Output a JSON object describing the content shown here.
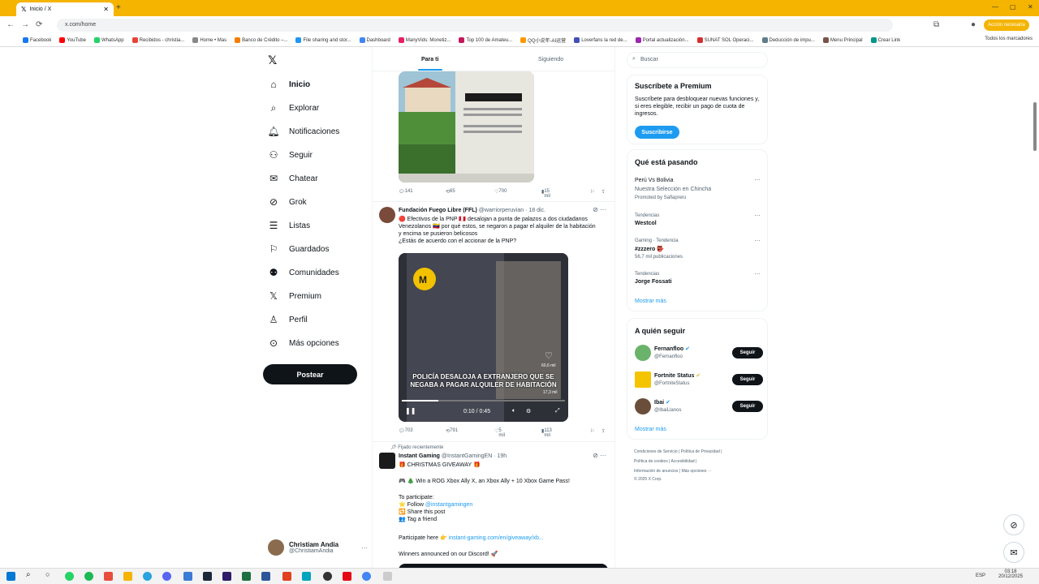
{
  "browser": {
    "tab_title": "Inicio / X",
    "address": "x.com/home",
    "update_label": "Acción necesaria",
    "bookmarks": [
      "Facebook",
      "YouTube",
      "WhatsApp",
      "Recibidos - christia...",
      "Home • Mas",
      "Banco de Crédito –...",
      "File sharing and stor...",
      "Dashboard",
      "ManyVids: Monetiz...",
      "Top 100 de Amateu...",
      "QQ小说年-AI运营",
      "Loverfans la red de...",
      "Portal actualización...",
      "SUNAT SOL Operaci...",
      "Deducción de impu...",
      "Menu Principal",
      "Crear Link"
    ],
    "bookmarks_right": "Todos los marcadores"
  },
  "nav": {
    "items": [
      {
        "label": "Inicio",
        "icon": "home-icon"
      },
      {
        "label": "Explorar",
        "icon": "search-icon"
      },
      {
        "label": "Notificaciones",
        "icon": "bell-icon"
      },
      {
        "label": "Seguir",
        "icon": "person-plus-icon"
      },
      {
        "label": "Chatear",
        "icon": "mail-icon"
      },
      {
        "label": "Grok",
        "icon": "grok-icon"
      },
      {
        "label": "Listas",
        "icon": "list-icon"
      },
      {
        "label": "Guardados",
        "icon": "bookmark-icon"
      },
      {
        "label": "Comunidades",
        "icon": "people-icon"
      },
      {
        "label": "Premium",
        "icon": "x-logo-icon"
      },
      {
        "label": "Perfil",
        "icon": "person-icon"
      },
      {
        "label": "Más opciones",
        "icon": "more-circle-icon"
      }
    ],
    "post_label": "Postear",
    "me_name": "Christiam Andia",
    "me_handle": "@ChristiamAndia"
  },
  "feed": {
    "tabs": [
      "Para ti",
      "Siguiendo"
    ],
    "post1": {
      "replies": "141",
      "reposts": "65",
      "likes": "700",
      "views": "15 mil"
    },
    "post2": {
      "name": "Fundación Fuego Libre (FFL)",
      "handle": "@warriorperuvian · 18 dic.",
      "text1": "🔴 Efectivos de la PNP 🇵🇪 desalojan a punta de palazos a dos ciudadanos",
      "text2": "Venezolanos 🇻🇪 por qué estos, se negaron a pagar el alquiler de la habitación",
      "text3": "y encima se pusieron belicosos",
      "text4": "¿Estás de acuerdo con el accionar de la PNP?",
      "video_caption": "POLICÍA DESALOJA A EXTRANJERO QUE SE NEGABA A PAGAR ALQUILER DE HABITACIÓN",
      "time": "0:10 / 0:45",
      "likes_overlay": "60,6 mil",
      "views_overlay": "17,3 mil",
      "replies": "703",
      "reposts": "791",
      "likes": "5 mil",
      "views": "113 mil"
    },
    "post3": {
      "pinned": "Fijado recientemente",
      "name": "Instant Gaming",
      "handle": "@InstantGamingEN · 19h",
      "line1": "🎁 CHRISTMAS GIVEAWAY 🎁",
      "line2": "🎮 🎄 Win a ROG Xbox Ally X, an Xbox Ally + 10 Xbox Game Pass!",
      "line3": "To participate:",
      "line4a": "⭐ Follow ",
      "line4b": "@instantgamingen",
      "line5": "🔁 Share this post",
      "line6": "👥 Tag a friend",
      "line7a": "Participate here 👉 ",
      "line7b": "instant-gaming.com/en/giveaway/xb...",
      "line8": "Winners announced on our Discord! 🚀"
    }
  },
  "right": {
    "search_placeholder": "Buscar",
    "premium_title": "Suscríbete a Premium",
    "premium_text": "Suscríbete para desbloquear nuevas funciones y, si eres elegible, recibir un pago de cuota de ingresos.",
    "premium_btn": "Suscribirse",
    "trends_title": "Qué está pasando",
    "trends": [
      {
        "top": "Perú Vs Bolivia",
        "mid": "Nuestra Selección en Chincha",
        "bot": "Promoted by Saflapreru"
      },
      {
        "top": "Tendencias",
        "mid": "Westcol",
        "bot": ""
      },
      {
        "top": "Gaming · Tendencia",
        "mid": "#zzzero 👺",
        "bot": "56,7 mil publicaciones"
      },
      {
        "top": "Tendencias",
        "mid": "Jorge Fossati",
        "bot": ""
      }
    ],
    "show_more": "Mostrar más",
    "follow_title": "A quién seguir",
    "follows": [
      {
        "name": "Fernanfloo",
        "handle": "@Fernanfloo",
        "btn": "Seguir",
        "color": "#6bb36b"
      },
      {
        "name": "Fortnite Status",
        "handle": "@FortniteStatus",
        "btn": "Seguir",
        "color": "#f5c400"
      },
      {
        "name": "Ibai",
        "handle": "@IbaiLlanos",
        "btn": "Seguir",
        "color": "#6b4e3a"
      }
    ],
    "show_more2": "Mostrar más",
    "footer": [
      "Condiciones de Servicio",
      "Política de Privacidad",
      "Política de cookies",
      "Accesibilidad",
      "Información de anuncios",
      "Más opciones ···",
      "© 2025 X Corp."
    ]
  },
  "taskbar": {
    "lang": "ESP",
    "time": "03:18",
    "date": "20/12/2025"
  }
}
